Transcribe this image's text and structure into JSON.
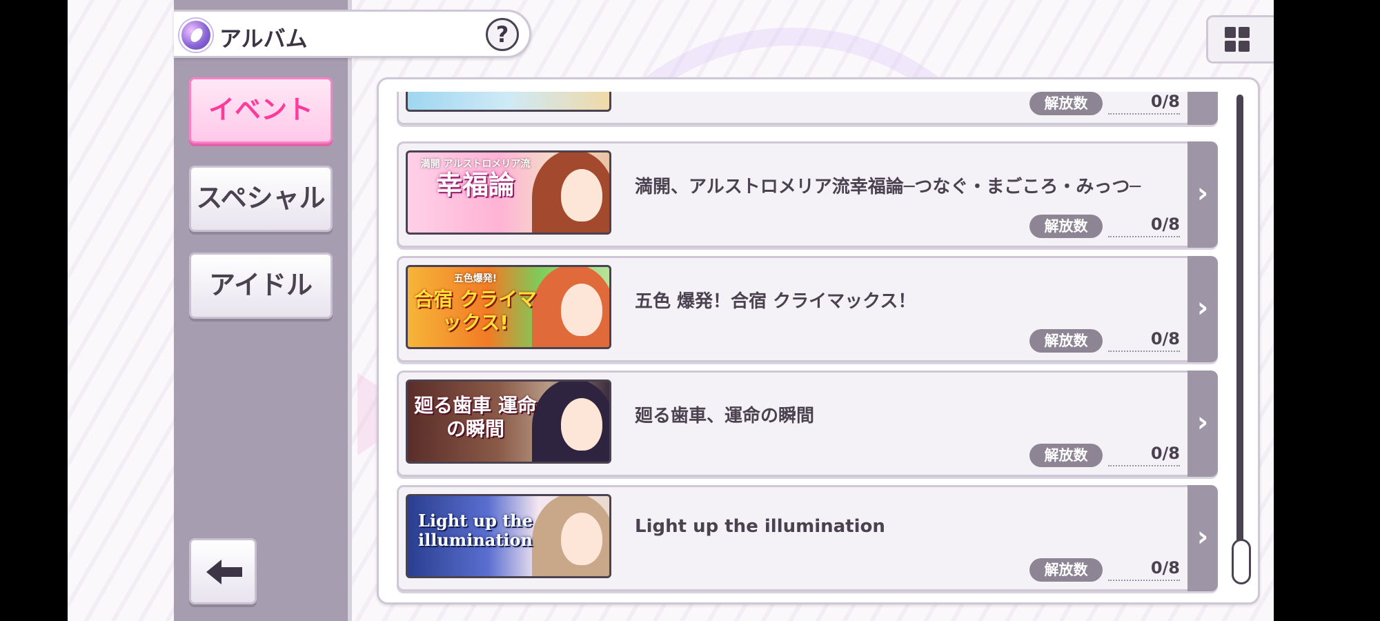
{
  "header": {
    "title": "アルバム",
    "help_label": "?"
  },
  "categories": [
    {
      "label": "イベント",
      "active": true
    },
    {
      "label": "スペシャル",
      "active": false
    },
    {
      "label": "アイドル",
      "active": false
    }
  ],
  "list_label": "解放数",
  "events": [
    {
      "title": "",
      "count": "0/8",
      "thumb_text": "",
      "thumb_sub": ""
    },
    {
      "title": "満開、アルストロメリア流幸福論─つなぐ・まごころ・みっつ─",
      "count": "0/8",
      "thumb_text": "幸福論",
      "thumb_sub": "満開 アルストロメリア流"
    },
    {
      "title": "五色 爆発！合宿 クライマックス！",
      "count": "0/8",
      "thumb_text": "合宿 クライマックス!",
      "thumb_sub": "五色爆発!"
    },
    {
      "title": "廻る歯車、運命の瞬間",
      "count": "0/8",
      "thumb_text": "廻る歯車 運命の瞬間",
      "thumb_sub": ""
    },
    {
      "title": "Light up the illumination",
      "count": "0/8",
      "thumb_text": "Light up the illumination",
      "thumb_sub": ""
    }
  ],
  "colors": {
    "accent_pink": "#ff3a9a",
    "sidebar": "#a79db0",
    "badge": "#8d8594",
    "text": "#4a4250"
  },
  "icons": {
    "album": "album-icon",
    "help": "help-icon",
    "grid": "grid-icon",
    "back": "back-arrow-icon",
    "chevron": "chevron-right-icon"
  }
}
